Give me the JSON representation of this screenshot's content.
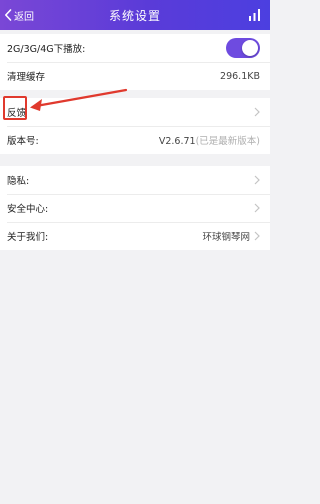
{
  "navbar": {
    "back_label": "返回",
    "title": "系统设置",
    "right_icon": "stats-icon",
    "back_icon": "chevron-left-icon"
  },
  "colors": {
    "nav_gradient_start": "#7a47d6",
    "nav_gradient_end": "#4c3fe0",
    "toggle_on": "#6e4be0",
    "annotation_red": "#e0392d"
  },
  "settings": {
    "play_on_cellular": {
      "label": "2G/3G/4G下播放:",
      "enabled": true
    },
    "clear_cache": {
      "label": "清理缓存",
      "value": "296.1KB"
    },
    "feedback": {
      "label": "反馈"
    },
    "version": {
      "label": "版本号:",
      "value": "V2.6.71",
      "note": "(已是最新版本)"
    },
    "privacy": {
      "label": "隐私:"
    },
    "security_center": {
      "label": "安全中心:"
    },
    "about_us": {
      "label": "关于我们:",
      "value": "环球钢琴网"
    }
  }
}
